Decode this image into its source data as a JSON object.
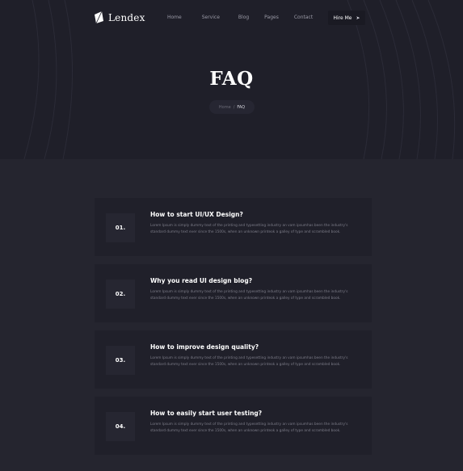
{
  "brand": {
    "name": "Lendex",
    "logo_icon": "leaf-page-logo-icon"
  },
  "nav": {
    "links": [
      "Home",
      "Service",
      "Blog",
      "Pages",
      "Contact"
    ],
    "cta_label": "Hire Me",
    "cta_icon": "arrow-right-icon"
  },
  "hero": {
    "title": "FAQ",
    "breadcrumb": {
      "home": "Home",
      "separator": "/",
      "current": "FAQ"
    }
  },
  "faq": {
    "items": [
      {
        "number": "01.",
        "question": "How to start UI/UX Design?",
        "answer": "Lorem Ipsum is simply dummy text of the printing and typesetting industry an vam ipsumhas been the industry's standard dummy text ever since the 1500s, when an unknown printeok a galley of type and scrambled book."
      },
      {
        "number": "02.",
        "question": "Why you read UI design blog?",
        "answer": "Lorem Ipsum is simply dummy text of the printing and typesetting industry an vam ipsumhas been the industry's standard dummy text ever since the 1500s, when an unknown printeok a galley of type and scrambled book."
      },
      {
        "number": "03.",
        "question": "How to improve design quality?",
        "answer": "Lorem Ipsum is simply dummy text of the printing and typesetting industry an vam ipsumhas been the industry's standard dummy text ever since the 1500s, when an unknown printeok a galley of type and scrambled book."
      },
      {
        "number": "04.",
        "question": "How to easily start user testing?",
        "answer": "Lorem Ipsum is simply dummy text of the printing and typesetting industry an vam ipsumhas been the industry's standard dummy text ever since the 1500s, when an unknown printeok a galley of type and scrambled book."
      }
    ]
  },
  "colors": {
    "page_bg": "#25252f",
    "hero_bg": "#1f1f29",
    "card_bg": "#20202a",
    "number_box_bg": "#262631",
    "muted_text": "#7c7c88"
  }
}
